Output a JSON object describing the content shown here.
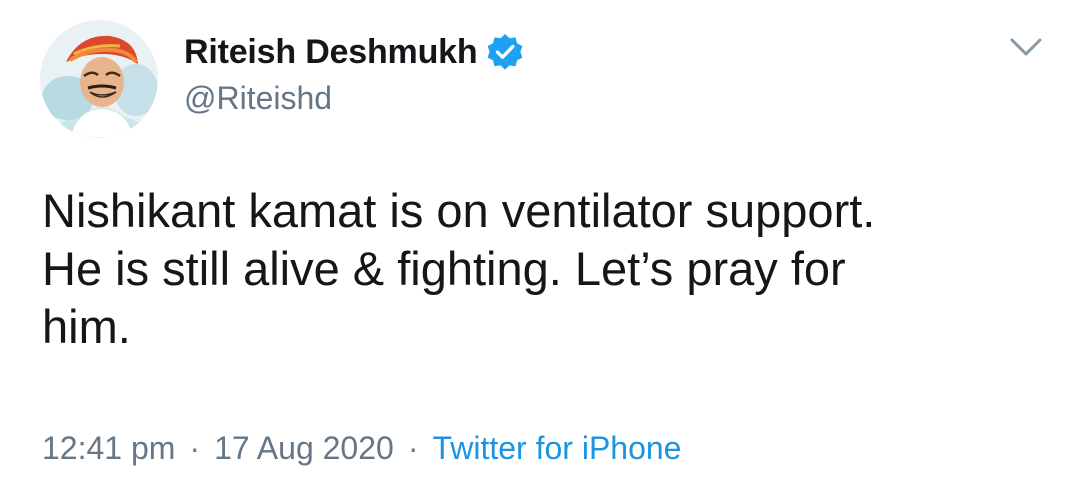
{
  "author": {
    "display_name": "Riteish Deshmukh",
    "handle": "@Riteishd",
    "verified": true,
    "avatar_icon": "profile-photo-avatar"
  },
  "tweet": {
    "text": "Nishikant kamat is on ventilator support.\nHe is still alive & fighting. Let’s pray for\nhim.",
    "time": "12:41 pm",
    "separator": "·",
    "date": "17 Aug 2020",
    "source": "Twitter for iPhone"
  },
  "icons": {
    "verified": "verified-badge-icon",
    "menu": "chevron-down-icon"
  },
  "colors": {
    "verified_blue": "#1da1f2",
    "link_blue": "#1b95e0",
    "secondary_text": "#657786",
    "primary_text": "#14171a"
  }
}
